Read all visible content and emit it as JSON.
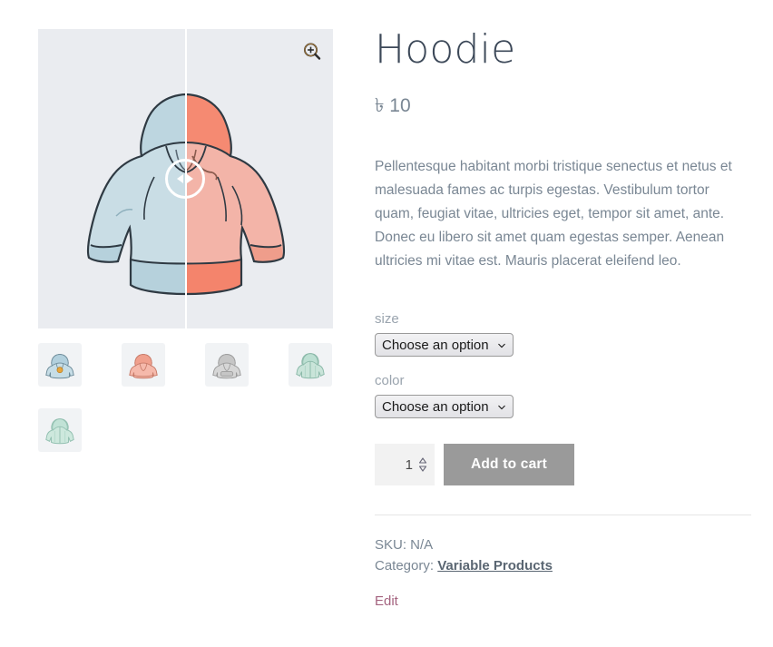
{
  "gallery": {
    "zoom_icon": "magnifier-plus-icon",
    "slider": {
      "handle_icon": "split-drag-handle",
      "left_arrow_icon": "triangle-left-icon",
      "right_arrow_icon": "triangle-right-icon",
      "before_label": "blue hoodie",
      "after_label": "red hoodie",
      "split_percent": 50
    },
    "main_image_alt": "Hoodie before after comparison",
    "thumbnails": [
      {
        "name": "thumbnail-blue-hoodie",
        "color": "#bcd4df",
        "alt": "Blue hoodie"
      },
      {
        "name": "thumbnail-red-hoodie",
        "color": "#f2b0a4",
        "alt": "Red hoodie"
      },
      {
        "name": "thumbnail-gray-hoodie",
        "color": "#cfcfcf",
        "alt": "Gray hoodie"
      },
      {
        "name": "thumbnail-green-hoodie",
        "color": "#c3e0d6",
        "alt": "Green zip hoodie"
      },
      {
        "name": "thumbnail-green-hoodie-2",
        "color": "#c9e3da",
        "alt": "Green zip hoodie alternate"
      }
    ]
  },
  "summary": {
    "title": "Hoodie",
    "price": "৳ 10",
    "currency_symbol": "৳",
    "price_amount": "10",
    "description": "Pellentesque habitant morbi tristique senectus et netus et malesuada fames ac turpis egestas. Vestibulum tortor quam, feugiat vitae, ultricies eget, tempor sit amet, ante. Donec eu libero sit amet quam egestas semper. Aenean ultricies mi vitae est. Mauris placerat eleifend leo.",
    "variations": [
      {
        "label": "size",
        "selected": "Choose an option",
        "options": [
          "Choose an option"
        ],
        "chevron_icon": "chevron-down-icon"
      },
      {
        "label": "color",
        "selected": "Choose an option",
        "options": [
          "Choose an option"
        ],
        "chevron_icon": "chevron-down-icon"
      }
    ],
    "quantity": "1",
    "add_to_cart_label": "Add to cart",
    "add_to_cart_color": "#9a9a9a",
    "meta": {
      "sku_label": "SKU:",
      "sku_value": "N/A",
      "sku_line": "SKU: N/A",
      "category_label": "Category:",
      "category_value": "Variable Products"
    },
    "edit_label": "Edit",
    "edit_color": "#a4637f"
  }
}
